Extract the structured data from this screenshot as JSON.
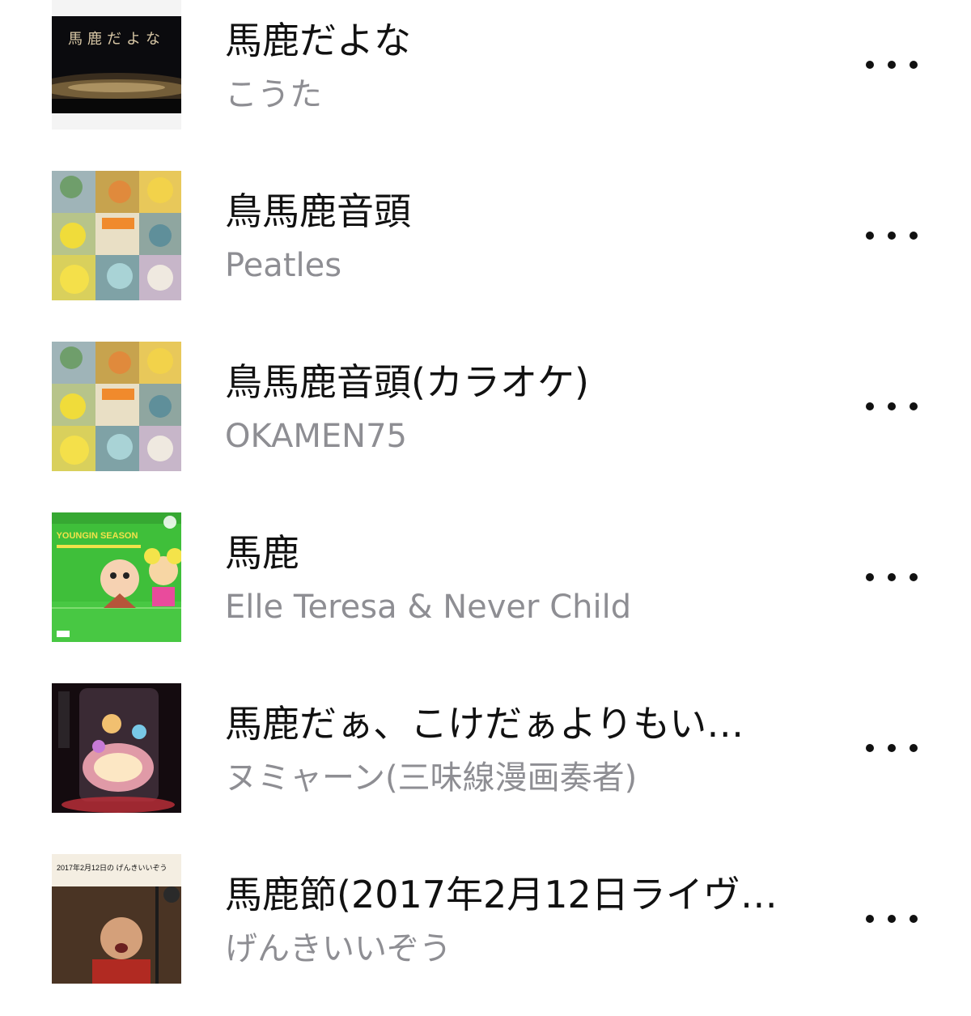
{
  "songs": [
    {
      "title": "馬鹿だよな",
      "artist": "こうた",
      "art": "night-city-art",
      "art_text": "馬鹿だよな"
    },
    {
      "title": "鳥馬鹿音頭",
      "artist": "Peatles",
      "art": "parakeet-collage-art"
    },
    {
      "title": "鳥馬鹿音頭(カラオケ)",
      "artist": "OKAMEN75",
      "art": "parakeet-collage-art"
    },
    {
      "title": "馬鹿",
      "artist": "Elle Teresa & Never Child",
      "art": "youngin-season-art",
      "art_text": "YOUNGIN SEASON"
    },
    {
      "title": "馬鹿だぁ、こけだぁよりもい…",
      "artist": "ヌミャーン(三味線漫画奏者)",
      "art": "glowing-jar-art"
    },
    {
      "title": "馬鹿節(2017年2月12日ライヴ…",
      "artist": "げんきいいぞう",
      "art": "live-photo-art",
      "art_text": "2017年2月12日の げんきいいぞう"
    }
  ],
  "icons": {
    "more": "ellipsis-icon"
  }
}
